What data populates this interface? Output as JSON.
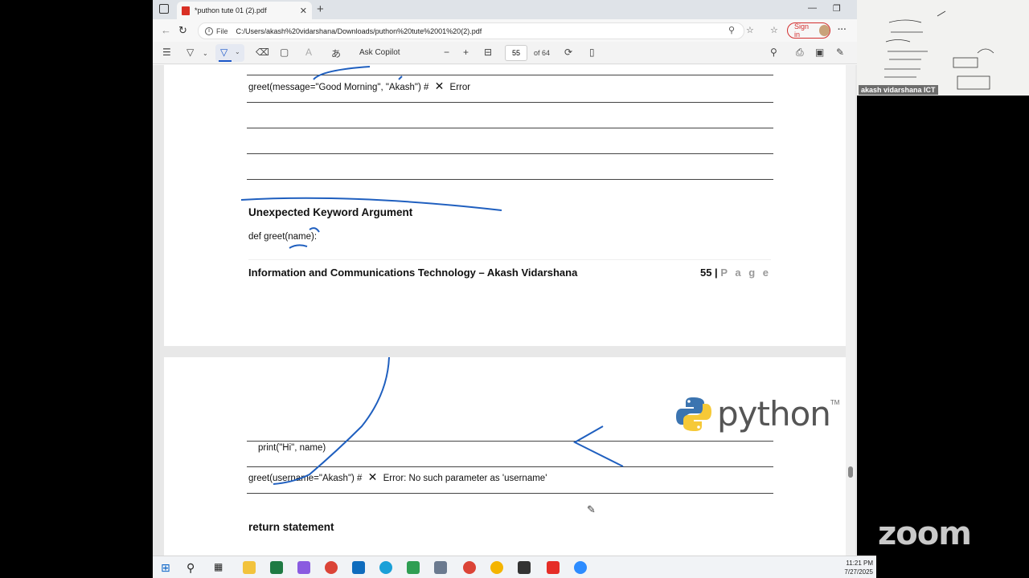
{
  "browser": {
    "tab_title": "*puthon tute 01 (2).pdf",
    "file_label": "File",
    "url": "C:/Users/akash%20vidarshana/Downloads/puthon%20tute%2001%20(2).pdf",
    "sign_in": "Sign in"
  },
  "pdf_toolbar": {
    "ask_copilot": "Ask Copilot",
    "page_number": "55",
    "page_total": "of 64"
  },
  "page_a": {
    "code_line": "greet(message=\"Good Morning\", \"Akash\")  #",
    "error_mark": "✕",
    "error_text": "Error",
    "heading": "Unexpected Keyword Argument",
    "def_line": "def greet(name):",
    "footer_left": "Information and Communications Technology – Akash Vidarshana",
    "footer_page": "55 |",
    "footer_page_word": "P a g e"
  },
  "page_b": {
    "print_line": "print(\"Hi\", name)",
    "code_line": "greet(username=\"Akash\")  #",
    "error_mark": "✕",
    "error_text": "Error: No such parameter as 'username'",
    "heading": "return statement",
    "logo_word": "python",
    "logo_tm": "TM"
  },
  "zoom": {
    "participant_name": "akash vidarshana ICT",
    "logo": "zoom"
  },
  "taskbar": {
    "time": "11:21 PM",
    "date": "7/27/2025"
  }
}
